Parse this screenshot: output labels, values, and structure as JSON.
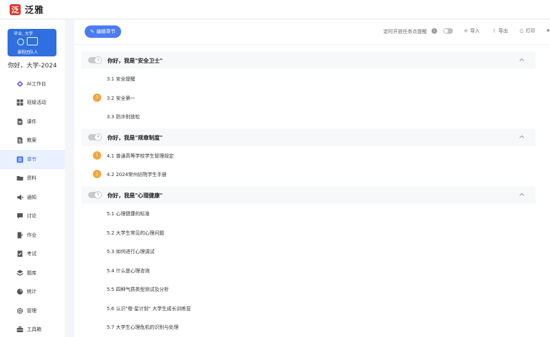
{
  "app": {
    "logo_char": "泛",
    "name": "泛雅"
  },
  "course": {
    "cover_doodle": "毕业, 大学",
    "cover_caption": "课程团队人",
    "name": "你好，大学-2024"
  },
  "nav": [
    {
      "label": "AI工作台",
      "icon": "ai-workbench-icon",
      "active": false
    },
    {
      "label": "班级活动",
      "icon": "grid-icon",
      "active": false
    },
    {
      "label": "课件",
      "icon": "file-icon",
      "active": false
    },
    {
      "label": "教案",
      "icon": "document-icon",
      "active": false
    },
    {
      "label": "章节",
      "icon": "list-icon",
      "active": true
    },
    {
      "label": "资料",
      "icon": "folder-icon",
      "active": false
    },
    {
      "label": "通知",
      "icon": "megaphone-icon",
      "active": false
    },
    {
      "label": "讨论",
      "icon": "chat-icon",
      "active": false
    },
    {
      "label": "作业",
      "icon": "edit-icon",
      "active": false
    },
    {
      "label": "考试",
      "icon": "exam-icon",
      "active": false
    },
    {
      "label": "题库",
      "icon": "stack-icon",
      "active": false
    },
    {
      "label": "统计",
      "icon": "pie-icon",
      "active": false
    },
    {
      "label": "管理",
      "icon": "gear-icon",
      "active": false
    },
    {
      "label": "工具箱",
      "icon": "toolbox-icon",
      "active": false
    }
  ],
  "toolbar": {
    "edit_label": "编辑章节",
    "remind_label": "定时开放任务点提醒",
    "import_label": "导入",
    "export_label": "导出",
    "print_label": "打印"
  },
  "chapters": [
    {
      "num": "3",
      "title": "你好，我是\"安全卫士\"",
      "sections": [
        {
          "label": "3.1 安全提醒",
          "badge": ""
        },
        {
          "label": "3.2 安全第一",
          "badge": "3"
        },
        {
          "label": "3.3 防诈别放松",
          "badge": ""
        }
      ]
    },
    {
      "num": "4",
      "title": "你好，我是\"规章制度\"",
      "sections": [
        {
          "label": "4.1 普通高等学校学生管理规定",
          "badge": "1"
        },
        {
          "label": "4.2 2024常州纺院学生手册",
          "badge": "1"
        }
      ]
    },
    {
      "num": "5",
      "title": "你好，我是\"心理健康\"",
      "sections": [
        {
          "label": "5.1 心理健康的标准",
          "badge": ""
        },
        {
          "label": "5.2 大学生常见的心理问题",
          "badge": ""
        },
        {
          "label": "5.3 如何进行心理调试",
          "badge": ""
        },
        {
          "label": "5.4 什么是心理咨询",
          "badge": ""
        },
        {
          "label": "5.5 四种气质类型测试及分析",
          "badge": ""
        },
        {
          "label": "5.6 认识\"橙·星计划\" 大学生成长训练营",
          "badge": ""
        },
        {
          "label": "5.7 大学生心理危机的识别与处理",
          "badge": ""
        }
      ]
    }
  ]
}
